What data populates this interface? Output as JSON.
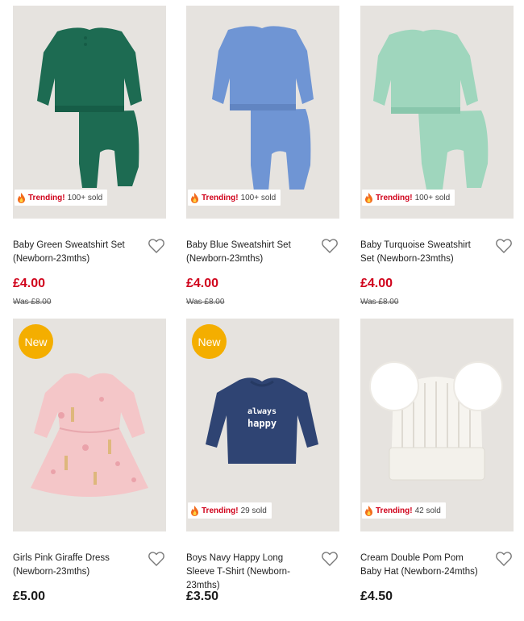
{
  "products": [
    {
      "name": "Baby Green Sweatshirt Set (Newborn-23mths)",
      "price": "£4.00",
      "was": "Was £8.00",
      "trend_label": "Trending!",
      "trend_count": "100+ sold",
      "colour": "#1d6b52"
    },
    {
      "name": "Baby Blue Sweatshirt Set (Newborn-23mths)",
      "price": "£4.00",
      "was": "Was £8.00",
      "trend_label": "Trending!",
      "trend_count": "100+ sold",
      "colour": "#6f95d4"
    },
    {
      "name": "Baby Turquoise Sweatshirt Set (Newborn-23mths)",
      "price": "£4.00",
      "was": "Was £8.00",
      "trend_label": "Trending!",
      "trend_count": "100+ sold",
      "colour": "#9fd6bd"
    },
    {
      "name": "Girls Pink Giraffe Dress (Newborn-23mths)",
      "price": "£5.00",
      "badge": "New",
      "colour": "#f4c6c8"
    },
    {
      "name": "Boys Navy Happy Long Sleeve T-Shirt (Newborn-23mths)",
      "price": "£3.50",
      "badge": "New",
      "trend_label": "Trending!",
      "trend_count": "29 sold",
      "colour": "#2f4473",
      "print_line1": "always",
      "print_line2": "happy"
    },
    {
      "name": "Cream Double Pom Pom Baby Hat (Newborn-24mths)",
      "price": "£4.50",
      "trend_label": "Trending!",
      "trend_count": "42 sold",
      "colour": "#f6f4ef"
    }
  ],
  "accent_sale": "#d0021b",
  "badge_colour": "#f4ae00",
  "icons": {
    "wishlist": "heart-outline-icon",
    "trending": "flame-icon"
  }
}
